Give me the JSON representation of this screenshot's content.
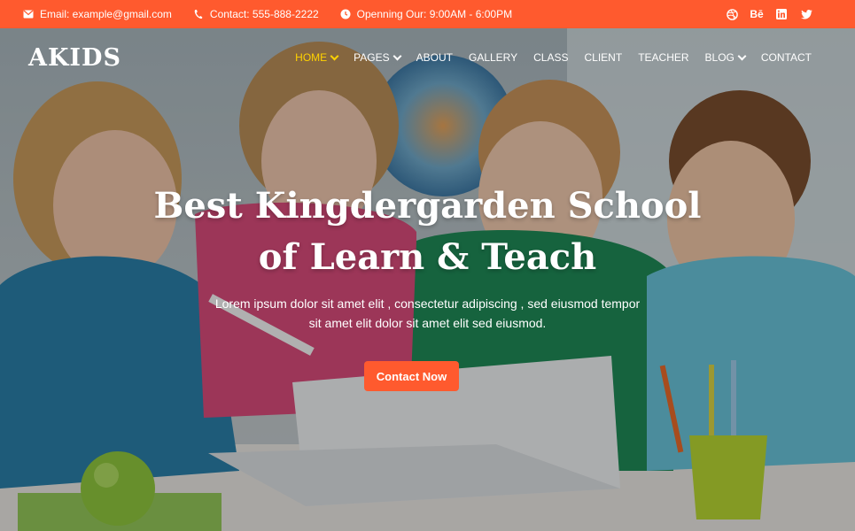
{
  "topbar": {
    "email": "Email: example@gmail.com",
    "contact": "Contact: 555-888-2222",
    "hours": "Openning Our: 9:00AM - 6:00PM",
    "social": [
      "dribbble-icon",
      "behance-icon",
      "linkedin-icon",
      "twitter-icon"
    ],
    "behance_text": "Bē",
    "linkedin_text": "in"
  },
  "nav": {
    "logo": "AKIDS",
    "items": [
      {
        "label": "HOME"
      },
      {
        "label": "PAGES"
      },
      {
        "label": "ABOUT"
      },
      {
        "label": "GALLERY"
      },
      {
        "label": "CLASS"
      },
      {
        "label": "CLIENT"
      },
      {
        "label": "TEACHER"
      },
      {
        "label": "BLOG"
      },
      {
        "label": "CONTACT"
      }
    ]
  },
  "hero": {
    "title_line1": "Best Kingdergarden School",
    "title_line2": "of Learn & Teach",
    "subtitle_line1": "Lorem ipsum dolor sit amet elit , consectetur adipiscing , sed eiusmod tempor",
    "subtitle_line2": "sit amet elit dolor sit amet elit sed eiusmod.",
    "cta": "Contact Now"
  },
  "colors": {
    "accent": "#ff5a2e",
    "active_nav": "#ffd200"
  }
}
